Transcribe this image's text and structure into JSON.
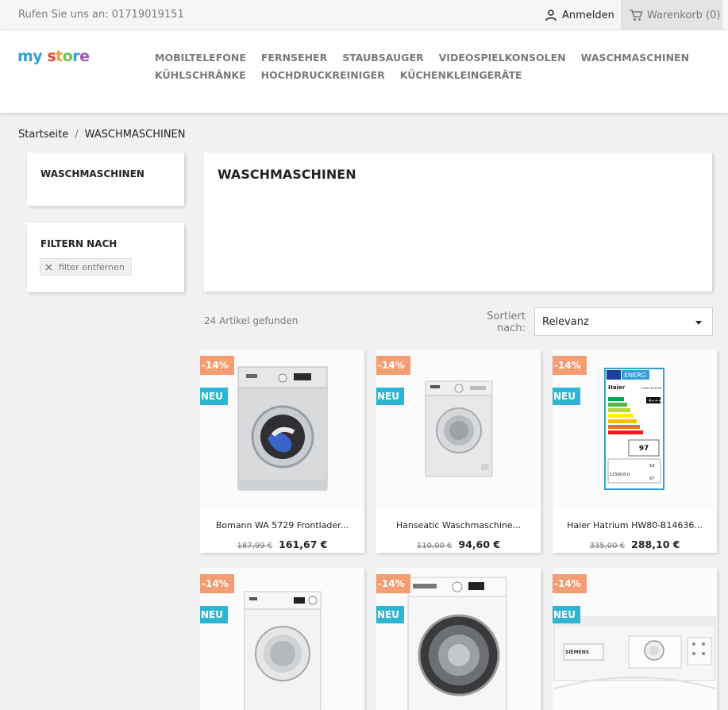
{
  "topbar": {
    "contact": "Rufen Sie uns an: 01719019151",
    "login": "Anmelden",
    "cart": "Warenkorb (0)"
  },
  "logo": {
    "part1": "my",
    "part2": "store"
  },
  "nav": {
    "row1": [
      "MOBILTELEFONE",
      "FERNSEHER",
      "STAUBSAUGER",
      "VIDEOSPIELKONSOLEN",
      "WASCHMASCHINEN"
    ],
    "row2": [
      "KÜHLSCHRÄNKE",
      "HOCHDRUCKREINIGER",
      "KÜCHENKLEINGERÄTE"
    ]
  },
  "breadcrumb": {
    "home": "Startseite",
    "separator": "/",
    "current": "WASCHMASCHINEN"
  },
  "sidebar": {
    "category": "WASCHMASCHINEN",
    "filter_title": "FILTERN NACH",
    "filter_chip": "filter entfernen"
  },
  "category": {
    "title": "WASCHMASCHINEN"
  },
  "listing": {
    "count": "24 Artikel gefunden",
    "sort_label": "Sortiert nach:",
    "sort_value": "Relevanz"
  },
  "products": [
    {
      "name": "Bomann WA 5729 Frontlader...",
      "old_price": "187,99 €",
      "price": "161,67 €",
      "discount": "-14%",
      "badge": "NEU"
    },
    {
      "name": "Hanseatic Waschmaschine...",
      "old_price": "110,00 €",
      "price": "94,60 €",
      "discount": "-14%",
      "badge": "NEU"
    },
    {
      "name": "Haier Hatrium HW80-B14636...",
      "old_price": "335,00 €",
      "price": "288,10 €",
      "discount": "-14%",
      "badge": "NEU"
    },
    {
      "discount": "-14%",
      "badge": "NEU"
    },
    {
      "discount": "-14%",
      "badge": "NEU"
    },
    {
      "discount": "-14%",
      "badge": "NEU"
    }
  ],
  "energy_label": {
    "header": "ENERG",
    "brand": "Haier",
    "model": "HW80-B14636",
    "class": "A+++",
    "kwh": "97",
    "l1": "11500",
    "l2": "8,0",
    "l3": "53",
    "l4": "67"
  },
  "product_brand_labels": {
    "siemens": "SIEMENS"
  },
  "colors": {
    "accent": "#2fb5d2",
    "discount": "#f39d72",
    "text": "#232323",
    "muted": "#7a7a7a"
  },
  "icons": {
    "login": "user-icon",
    "cart": "shopping-cart-icon",
    "chip": "close-icon",
    "sort": "caret-down-icon"
  }
}
